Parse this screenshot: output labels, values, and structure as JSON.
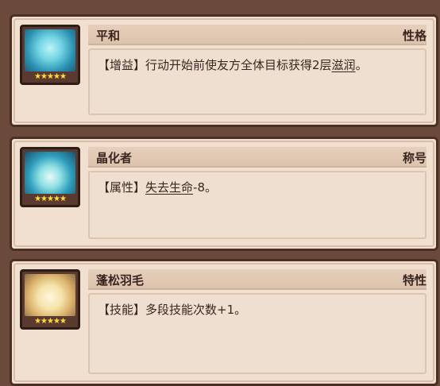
{
  "cards": [
    {
      "name": "平和",
      "tag": "性格",
      "desc_prefix": "【增益】行动开始前使友方全体目标获得2层",
      "desc_keyword": "滋润",
      "desc_suffix": "。",
      "stars": "★★★★★",
      "portrait_color": "#4ec5d8"
    },
    {
      "name": "晶化者",
      "tag": "称号",
      "desc_prefix": "【属性】",
      "desc_keyword": "失去生命",
      "desc_suffix": "-8。",
      "stars": "★★★★★",
      "portrait_color": "#3aa7c2"
    },
    {
      "name": "蓬松羽毛",
      "tag": "特性",
      "desc_prefix": "【技能】多段技能次数+1。",
      "desc_keyword": "",
      "desc_suffix": "",
      "stars": "★★★★★",
      "portrait_color": "#f3dea6"
    }
  ]
}
